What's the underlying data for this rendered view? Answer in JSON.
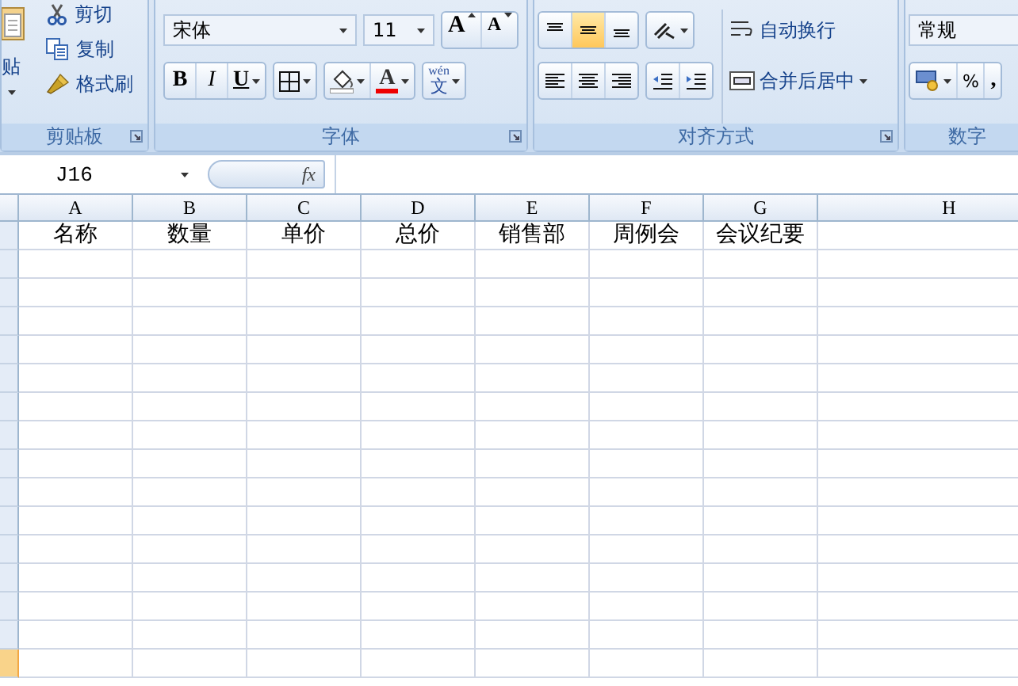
{
  "ribbon": {
    "groups": [
      {
        "kind": "clipboard",
        "label": "剪贴板",
        "paste_label": "贴",
        "items": [
          {
            "kind": "cut",
            "label": "剪切"
          },
          {
            "kind": "copy",
            "label": "复制"
          },
          {
            "kind": "brush",
            "label": "格式刷"
          }
        ]
      },
      {
        "kind": "font",
        "label": "字体",
        "font_name": "宋体",
        "font_size": "11",
        "grow": "A",
        "shrink": "A",
        "bold": "B",
        "italic": "I",
        "underline": "U",
        "font_color": "A",
        "phonetic_hint": "wén",
        "phonetic": "文"
      },
      {
        "kind": "alignment",
        "label": "对齐方式",
        "vertical": [
          {
            "selected": false
          },
          {
            "selected": true
          },
          {
            "selected": false
          }
        ],
        "horizontal": [
          {
            "selected": false
          },
          {
            "selected": false
          },
          {
            "selected": false
          }
        ],
        "wrap": "自动换行",
        "merge": "合并后居中"
      },
      {
        "kind": "number",
        "label": "数字",
        "format": "常规",
        "percent": "%",
        "comma": ","
      }
    ]
  },
  "formula_bar": {
    "name_box": "J16",
    "fx": "fx"
  },
  "sheet": {
    "columns": [
      "A",
      "B",
      "C",
      "D",
      "E",
      "F",
      "G",
      "H"
    ],
    "rows": [
      {
        "selected": false,
        "cells": [
          "名称",
          "数量",
          "单价",
          "总价",
          "销售部",
          "周例会",
          "会议纪要"
        ]
      },
      {
        "selected": false
      },
      {
        "selected": false
      },
      {
        "selected": false
      },
      {
        "selected": false
      },
      {
        "selected": false
      },
      {
        "selected": false
      },
      {
        "selected": false
      },
      {
        "selected": false
      },
      {
        "selected": false
      },
      {
        "selected": false
      },
      {
        "selected": false
      },
      {
        "selected": false
      },
      {
        "selected": false
      },
      {
        "selected": false
      },
      {
        "selected": true
      }
    ]
  }
}
